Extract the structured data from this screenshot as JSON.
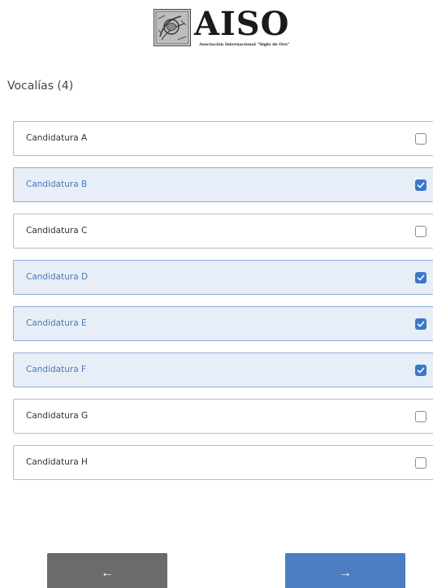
{
  "logo": {
    "name": "AISO",
    "subtitle": "Asociación Internacional \"Siglo de Oro\""
  },
  "section": {
    "title": "Vocalías (4)"
  },
  "options": [
    {
      "label": "Candidatura A",
      "checked": false
    },
    {
      "label": "Candidatura B",
      "checked": true
    },
    {
      "label": "Candidatura C",
      "checked": false
    },
    {
      "label": "Candidatura D",
      "checked": true
    },
    {
      "label": "Candidatura E",
      "checked": true
    },
    {
      "label": "Candidatura F",
      "checked": true
    },
    {
      "label": "Candidatura G",
      "checked": false
    },
    {
      "label": "Candidatura H",
      "checked": false
    }
  ],
  "nav": {
    "prev_label": "←",
    "next_label": "→"
  },
  "colors": {
    "selected_background": "#e8eef7",
    "selected_border": "#8eaedb",
    "checkbox_checked": "#3a78c8",
    "prev_button": "#6b6b6b",
    "next_button": "#4c7dc2"
  },
  "icons": {
    "logo_emblem": "engraved-emblem-icon",
    "checked": "checkmark-icon",
    "prev": "arrow-left-icon",
    "next": "arrow-right-icon"
  }
}
